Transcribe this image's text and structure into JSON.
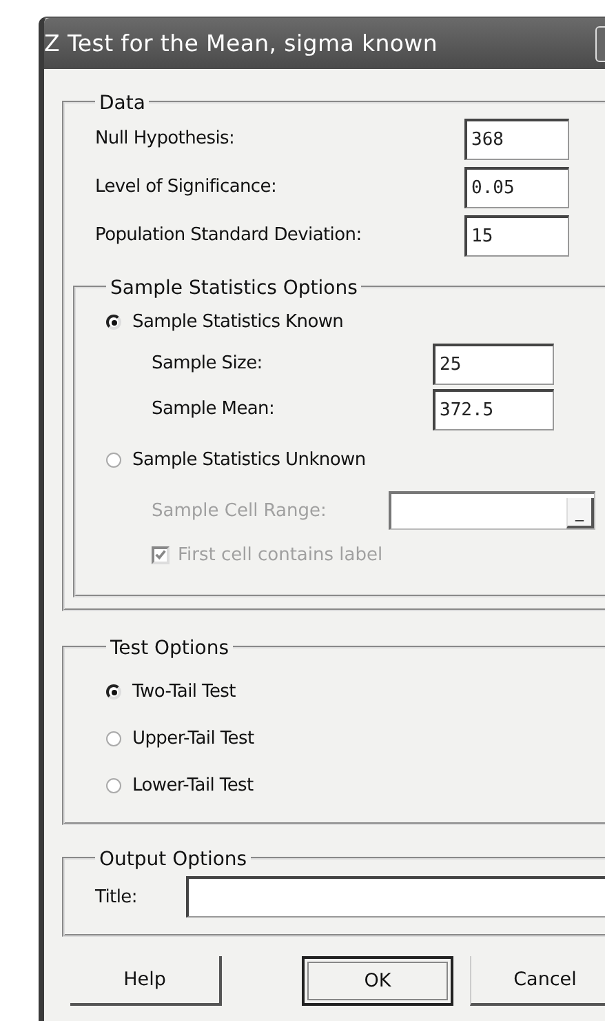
{
  "window": {
    "title": "Z Test for the Mean, sigma known"
  },
  "data": {
    "legend": "Data",
    "fields": [
      {
        "label": "Null Hypothesis:",
        "value": "368"
      },
      {
        "label": "Level of Significance:",
        "value": "0.05"
      },
      {
        "label": "Population Standard Deviation:",
        "value": "15"
      }
    ]
  },
  "sample_statistics": {
    "legend": "Sample Statistics Options",
    "known": {
      "label": "Sample Statistics Known",
      "selected": true
    },
    "known_fields": [
      {
        "label": "Sample Size:",
        "value": "25"
      },
      {
        "label": "Sample Mean:",
        "value": "372.5"
      }
    ],
    "unknown": {
      "label": "Sample Statistics Unknown",
      "selected": false
    },
    "cell_range": {
      "label": "Sample Cell Range:",
      "button": "_",
      "disabled": true
    },
    "first_cell_label": {
      "label": "First cell contains label",
      "checked": true,
      "disabled": true
    }
  },
  "test_options": {
    "legend": "Test Options",
    "options": [
      {
        "label": "Two-Tail Test",
        "selected": true
      },
      {
        "label": "Upper-Tail Test",
        "selected": false
      },
      {
        "label": "Lower-Tail Test",
        "selected": false
      }
    ]
  },
  "output_options": {
    "legend": "Output Options",
    "title_label": "Title:"
  },
  "buttons": [
    {
      "label": "Help",
      "kind": "plain"
    },
    {
      "label": "OK",
      "kind": "default"
    },
    {
      "label": "Cancel",
      "kind": "plain"
    }
  ]
}
